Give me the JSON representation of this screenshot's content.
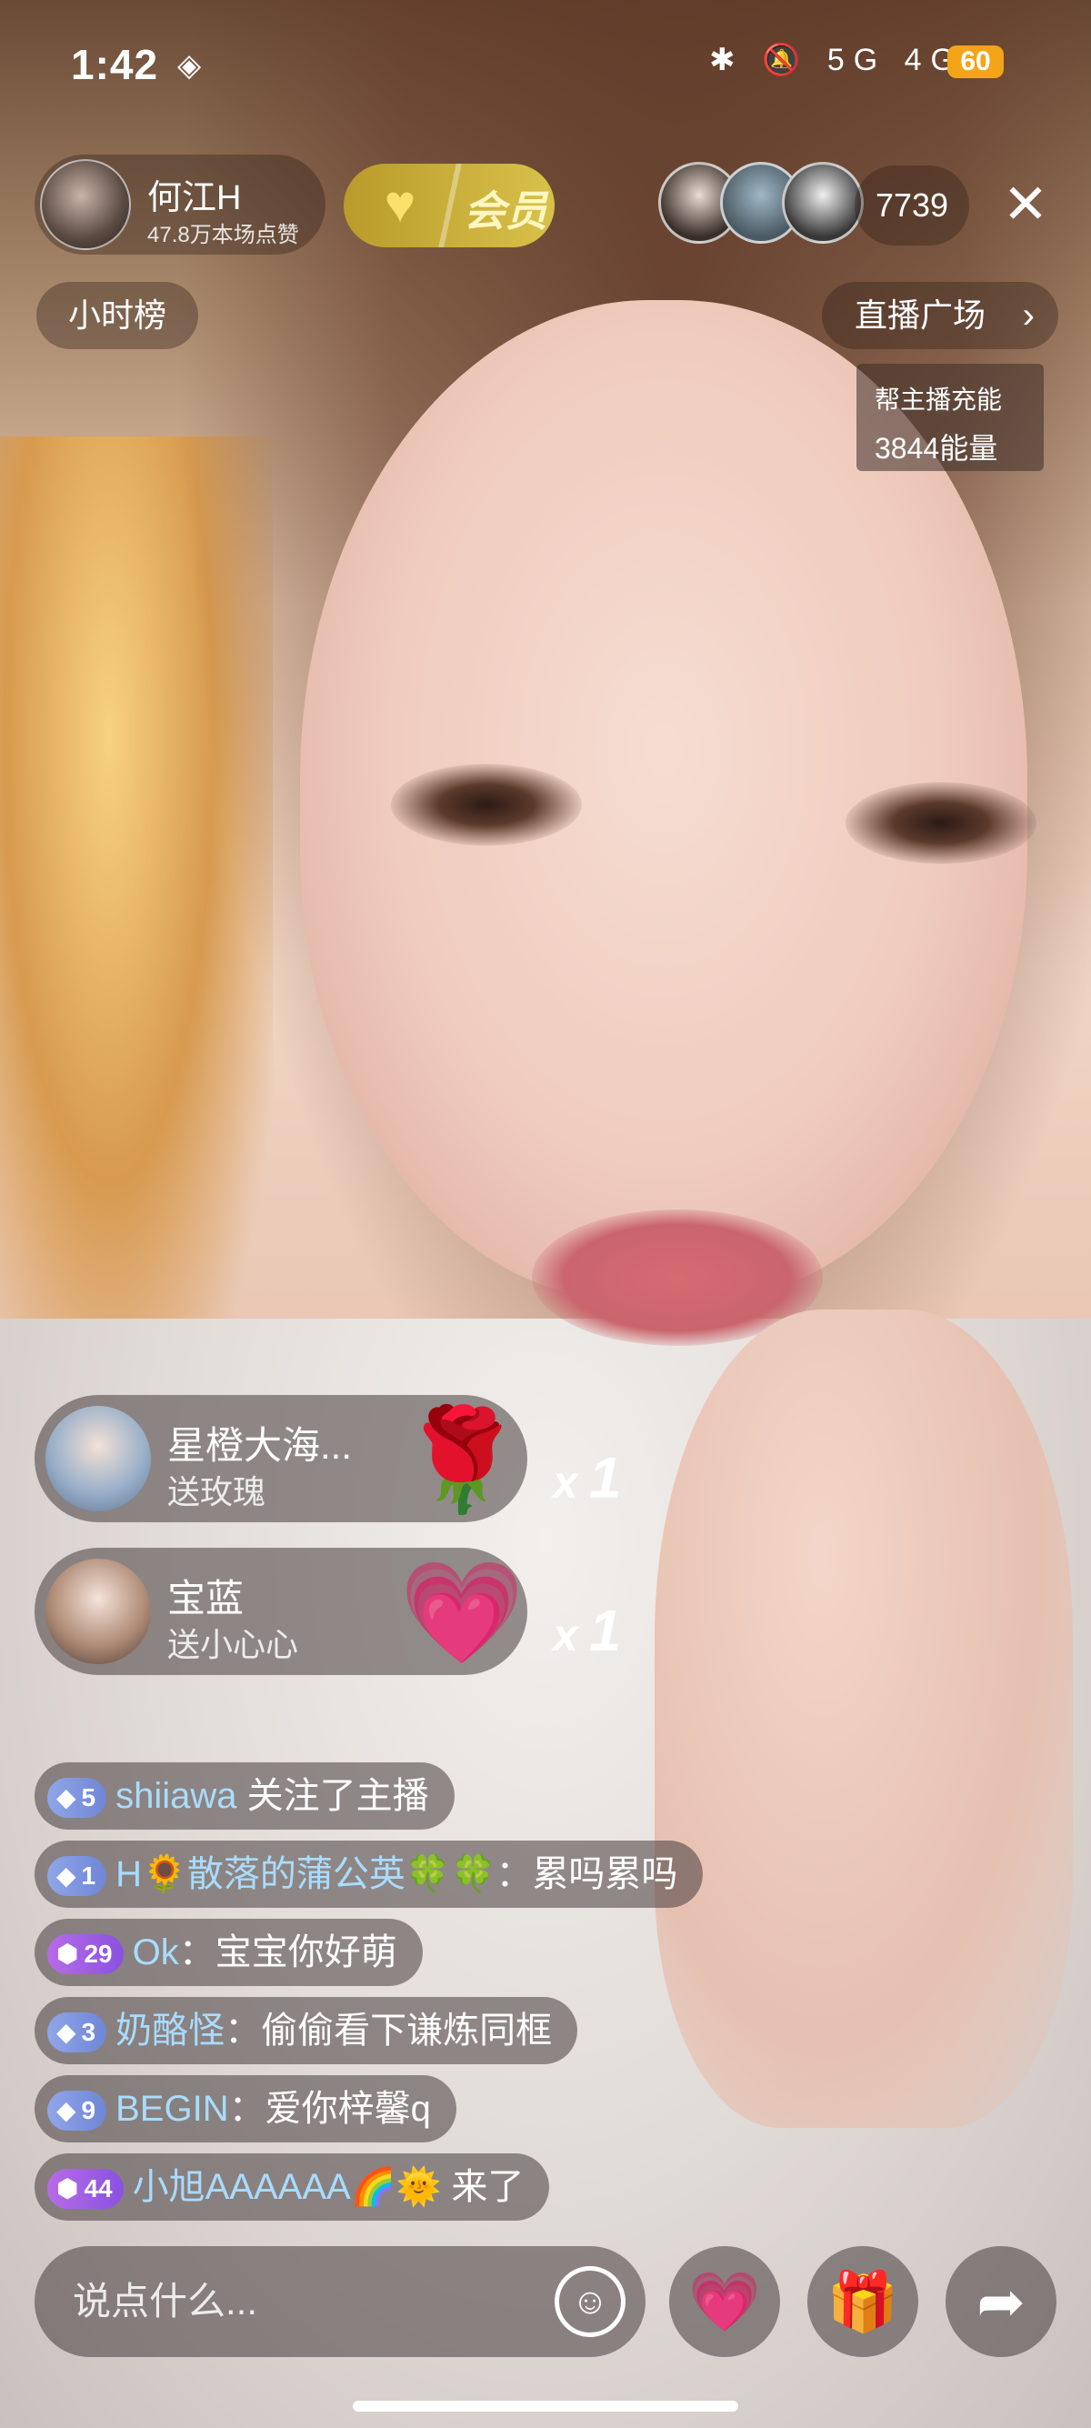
{
  "status_bar": {
    "time": "1:42",
    "layers_icon": "layers-icon",
    "signal_text": "5G 4G",
    "battery": "60"
  },
  "anchor": {
    "name": "何江H",
    "likes": "47.8万本场点赞"
  },
  "vip": {
    "label": "会员",
    "icon": "heart-plus-icon"
  },
  "audience": {
    "count": "7739"
  },
  "hourly_rank": "小时榜",
  "live_plaza": "直播广场",
  "energy": {
    "line1": "帮主播充能",
    "line2": "3844能量"
  },
  "gifts": [
    {
      "name": "星橙大海...",
      "action": "送玫瑰",
      "icon": "rose-icon",
      "glyph": "🌹",
      "count": "1",
      "x": "x"
    },
    {
      "name": "宝蓝",
      "action": "送小心心",
      "icon": "heart-icon",
      "glyph": "💗",
      "count": "1",
      "x": "x"
    }
  ],
  "chat": [
    {
      "level": "5",
      "badge": "blue",
      "user": "shiiawa",
      "sep": " ",
      "text": "关注了主播"
    },
    {
      "level": "1",
      "badge": "blue",
      "user": "H🌻散落的蒲公英🍀🍀",
      "sep": "：",
      "text": "累吗累吗"
    },
    {
      "level": "29",
      "badge": "purple",
      "user": "Ok",
      "sep": "：",
      "text": "宝宝你好萌"
    },
    {
      "level": "3",
      "badge": "blue",
      "user": "奶酪怪",
      "sep": "：",
      "text": "偷偷看下谦炼同框"
    },
    {
      "level": "9",
      "badge": "blue",
      "user": "BEGIN",
      "sep": "：",
      "text": "爱你梓馨q"
    },
    {
      "level": "44",
      "badge": "purple",
      "user": "小旭AAAAAA🌈🌞",
      "sep": " ",
      "text": "来了"
    }
  ],
  "input": {
    "placeholder": "说点什么..."
  },
  "buttons": {
    "emoji_icon": "smile-icon",
    "heart_icon": "heart-gift-icon",
    "gift_icon": "gift-box-icon",
    "share_icon": "share-arrow-icon"
  }
}
